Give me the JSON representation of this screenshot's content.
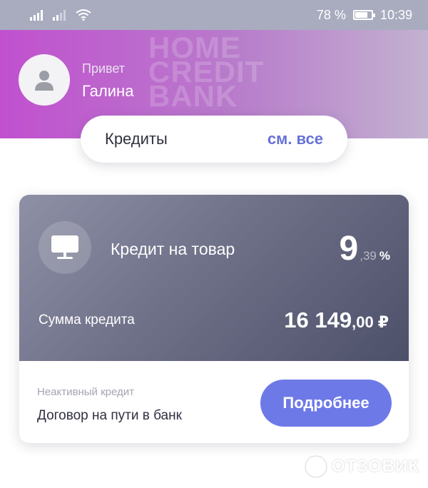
{
  "status_bar": {
    "battery_text": "78 %",
    "time": "10:39",
    "battery_level": 0.78
  },
  "header": {
    "greeting": "Привет",
    "user_name": "Галина",
    "watermark_lines": [
      "HOME",
      "CREDIT",
      "BANK"
    ],
    "gradient_colors": [
      "#c150cf",
      "#c2b2d0"
    ]
  },
  "credits_section": {
    "title": "Кредиты",
    "see_all_label": "см. все",
    "accent_color": "#6672d6"
  },
  "credit_card": {
    "product_icon": "monitor-icon",
    "product_title": "Кредит на товар",
    "rate_integer": "9",
    "rate_fraction": ",39",
    "rate_unit": "%",
    "sum_label": "Сумма кредита",
    "sum_integer": "16 149",
    "sum_fraction": ",00",
    "sum_currency": "₽",
    "status_label": "Неактивный кредит",
    "status_text": "Договор на пути в банк",
    "details_button_label": "Подробнее",
    "button_color": "#6e79e8"
  },
  "watermark": {
    "text": "ОТЗОВИК"
  }
}
